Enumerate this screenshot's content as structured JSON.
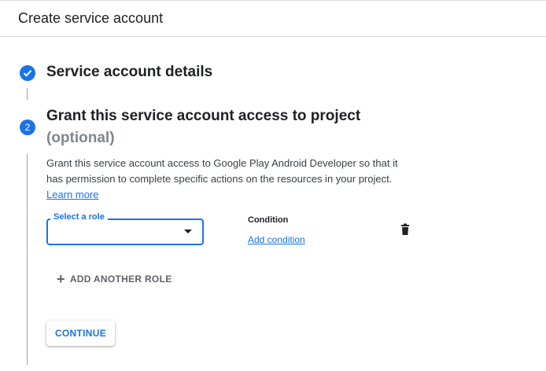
{
  "header": {
    "title": "Create service account"
  },
  "steps": [
    {
      "status": "complete",
      "title": "Service account details"
    },
    {
      "number": "2",
      "title": "Grant this service account access to project",
      "optional": "(optional)",
      "description": "Grant this service account access to Google Play Android Developer so that it has permission to complete specific actions on the resources in your project.",
      "learn_more": "Learn more"
    }
  ],
  "role": {
    "label": "Select a role",
    "value": ""
  },
  "condition": {
    "label": "Condition",
    "add_link": "Add condition"
  },
  "add_role_label": "ADD ANOTHER ROLE",
  "continue_label": "CONTINUE",
  "colors": {
    "accent": "#1a73e8"
  }
}
